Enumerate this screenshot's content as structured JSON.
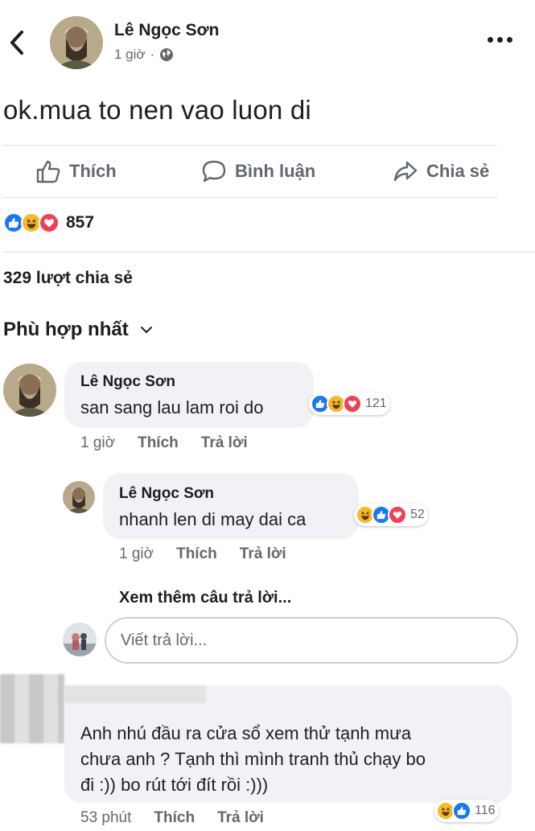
{
  "post": {
    "author": "Lê Ngọc Sơn",
    "time": "1 giờ",
    "separator": "·",
    "text": "ok.mua to nen vao luon di",
    "reaction_count": "857",
    "shares": "329 lượt chia sẻ"
  },
  "actions": {
    "like": "Thích",
    "comment": "Bình luận",
    "share": "Chia sẻ"
  },
  "sort_label": "Phù hợp nhất",
  "comments": [
    {
      "author": "Lê Ngọc Sơn",
      "text": "san sang lau lam roi do",
      "reactions": [
        "like",
        "haha",
        "love"
      ],
      "reaction_count": "121",
      "time": "1 giờ",
      "like": "Thích",
      "reply": "Trả lời"
    },
    {
      "author": "Lê Ngọc Sơn",
      "text": "nhanh len di may dai ca",
      "reactions": [
        "haha",
        "like",
        "love"
      ],
      "reaction_count": "52",
      "time": "1 giờ",
      "like": "Thích",
      "reply": "Trả lời"
    },
    {
      "author": "",
      "text_lines": [
        "Anh nhú đầu ra cửa sổ xem thử tạnh mưa",
        "chưa anh ? Tạnh thì mình tranh thủ chạy bo",
        "đi :)) bo rút tới đít rồi :)))"
      ],
      "reactions": [
        "haha",
        "like"
      ],
      "reaction_count": "116",
      "time": "53 phút",
      "like": "Thích",
      "reply": "Trả lời"
    }
  ],
  "see_more_replies": "Xem thêm câu trả lời...",
  "reply_placeholder": "Viết trả lời...",
  "colors": {
    "like_blue": "#1877f2",
    "haha_yellow": "#f7b928",
    "love_red": "#f33e58",
    "bubble_bg": "#f0f2f5",
    "muted_text": "#65676b"
  },
  "icons": {
    "back": "chevron-left-icon",
    "more": "more-horizontal-icon",
    "privacy": "globe-icon",
    "like": "thumbs-up-icon",
    "comment": "speech-bubble-icon",
    "share": "share-arrow-icon",
    "sort": "chevron-down-icon"
  }
}
